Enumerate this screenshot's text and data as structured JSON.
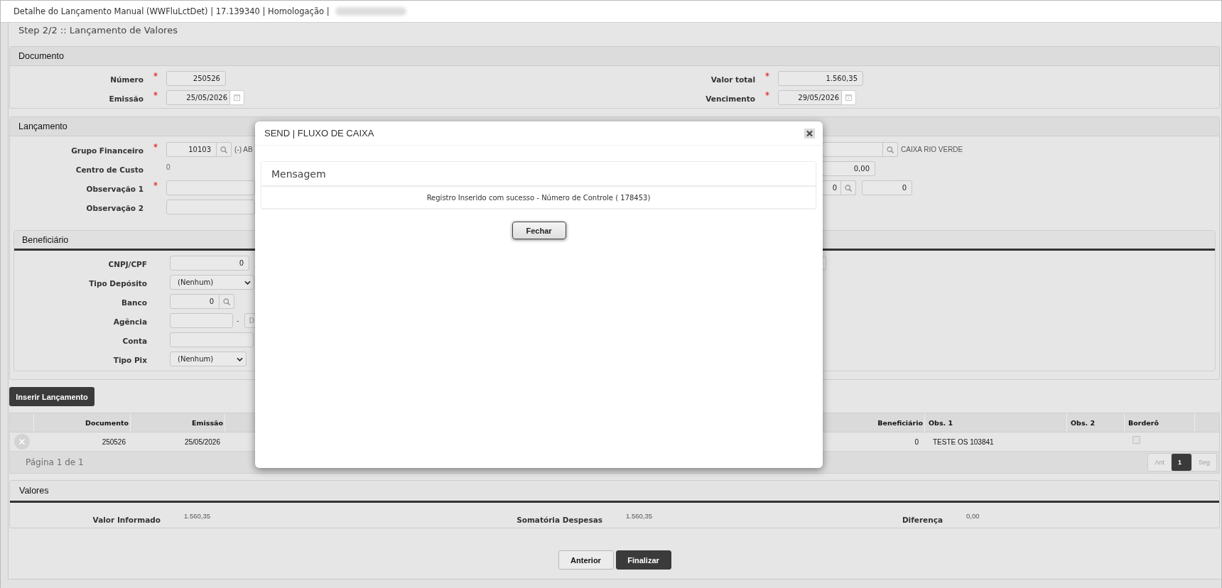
{
  "window": {
    "title": "Detalhe do Lançamento Manual (WWFluLctDet) | 17.139340 | Homologação |"
  },
  "step_title": "Step 2/2 :: Lançamento de Valores",
  "documento": {
    "title": "Documento",
    "left_fields": [
      {
        "label": "Número",
        "required": true,
        "kind": "text",
        "value": "250526"
      },
      {
        "label": "Emissão",
        "required": true,
        "kind": "date",
        "value": "25/05/2026"
      }
    ],
    "right_fields": [
      {
        "label": "Valor total",
        "required": true,
        "kind": "text",
        "value": "1.560,35"
      },
      {
        "label": "Vencimento",
        "required": true,
        "kind": "date",
        "value": "29/05/2026"
      }
    ]
  },
  "lancamento": {
    "title": "Lançamento",
    "left_fields": [
      {
        "label": "Grupo Financeiro",
        "required": true,
        "kind": "lookup",
        "value": "10103",
        "description": "(-) AB"
      },
      {
        "label": "Centro de Custo",
        "required": false,
        "kind": "static",
        "value": "0"
      },
      {
        "label": "Observação 1",
        "required": true,
        "kind": "text"
      },
      {
        "label": "Observação 2",
        "required": false,
        "kind": "text"
      }
    ],
    "right_fields": [
      {
        "kind": "lookup",
        "description": "CAIXA RIO VERDE"
      },
      {
        "kind": "text",
        "value": "0,00"
      },
      {
        "kind": "lookup_pair",
        "value": "0",
        "value_2": "0"
      }
    ]
  },
  "beneficiario": {
    "title": "Beneficiário",
    "left_fields": [
      {
        "label": "CNPJ/CPF",
        "kind": "text",
        "value": "0"
      },
      {
        "label": "Tipo Depósito",
        "kind": "select",
        "value": "(Nenhum)"
      },
      {
        "label": "Banco",
        "kind": "lookup",
        "value": "0"
      },
      {
        "label": "Agência",
        "kind": "split",
        "separator": "-",
        "placeholder": "D"
      },
      {
        "label": "Conta",
        "kind": "text"
      },
      {
        "label": "Tipo Pix",
        "kind": "select",
        "value": "(Nenhum)"
      }
    ],
    "right_fields": [
      {
        "kind": "text"
      }
    ]
  },
  "insert_button": "Inserir Lançamento",
  "table": {
    "columns": [
      "Documento",
      "Emissão",
      "Beneficiário",
      "Obs. 1",
      "Obs. 2",
      "Borderô"
    ],
    "rows": [
      {
        "documento": "250526",
        "emissao": "25/05/2026",
        "beneficiario": "0",
        "obs_1": "TESTE OS 103841",
        "bordero_checked": false
      }
    ],
    "pager": {
      "text": "Página 1 de 1",
      "pages": [
        {
          "label": "Ant",
          "selected": false,
          "disabled": true
        },
        {
          "label": "1",
          "selected": true,
          "disabled": false
        },
        {
          "label": "Seg",
          "selected": false,
          "disabled": true
        }
      ]
    }
  },
  "valores": {
    "title": "Valores",
    "items": [
      {
        "label": "Valor Informado",
        "value": "1.560,35"
      },
      {
        "label": "Somatória Despesas",
        "value": "1.560,35"
      },
      {
        "label": "Diferença",
        "value": "0,00"
      }
    ]
  },
  "footer_buttons": [
    {
      "label": "Anterior",
      "kind": "secondary"
    },
    {
      "label": "Finalizar",
      "kind": "primary"
    }
  ],
  "dialog": {
    "title": "SEND | FLUXO DE CAIXA",
    "message_title": "Mensagem",
    "message": "Registro Inserido com sucesso - Número de Controle ( 178453)",
    "button": "Fechar"
  }
}
